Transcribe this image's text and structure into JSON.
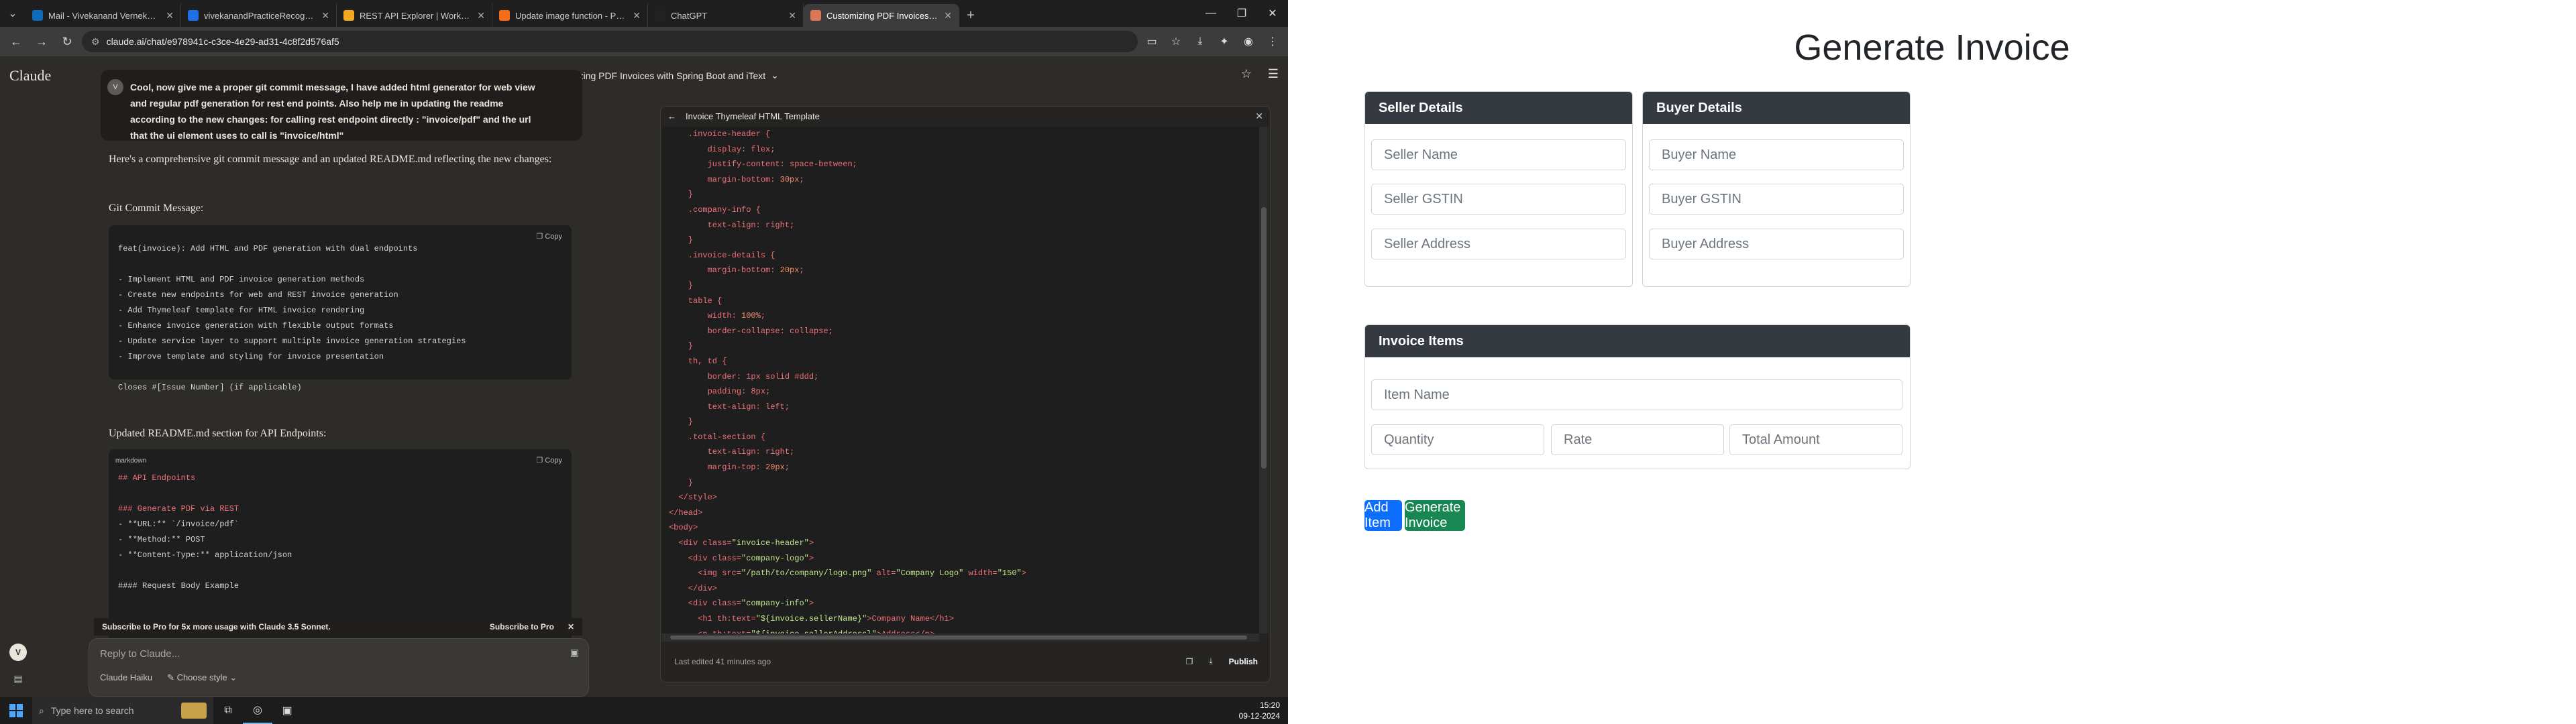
{
  "browser": {
    "tabs": [
      {
        "label": "Mail - Vivekanand Vernekar - O",
        "favicon_color": "#0f6cbd",
        "icon": "mail-icon"
      },
      {
        "label": "vivekanandPracticeRecognitio",
        "favicon_color": "#1f6feb",
        "icon": "github-icon"
      },
      {
        "label": "REST API Explorer | Workday Da",
        "favicon_color": "#f5a623",
        "icon": "workday-icon"
      },
      {
        "label": "Update image function - Post ·",
        "favicon_color": "#f76b15",
        "icon": "postman-icon"
      },
      {
        "label": "ChatGPT",
        "favicon_color": "#222222",
        "icon": "chatgpt-icon"
      },
      {
        "label": "Customizing PDF Invoices with",
        "favicon_color": "#d97757",
        "icon": "claude-icon",
        "active": true
      }
    ],
    "url": "claude.ai/chat/e978941c-c3ce-4e29-ad31-4c8f2d576af5"
  },
  "claude": {
    "brand": "Claude",
    "conversation_title": "Customizing PDF Invoices with Spring Boot and iText",
    "user_message": [
      "Cool, now give me a proper git commit message, I have added html generator for web view",
      "and regular pdf generation for rest end points. Also help me in updating the readme",
      "according to the new changes: for calling rest endpoint directly : \"invoice/pdf\" and the url",
      "that the ui element uses to call is \"invoice/html\""
    ],
    "user_initial": "V",
    "assistant_intro": "Here's a comprehensive git commit message and an updated README.md reflecting the new changes:",
    "git_heading": "Git Commit Message:",
    "copy_label": "Copy",
    "commit_lines": [
      "feat(invoice): Add HTML and PDF generation with dual endpoints",
      "",
      "- Implement HTML and PDF invoice generation methods",
      "- Create new endpoints for web and REST invoice generation",
      "- Add Thymeleaf template for HTML invoice rendering",
      "- Enhance invoice generation with flexible output formats",
      "- Update service layer to support multiple invoice generation strategies",
      "- Improve template and styling for invoice presentation",
      "",
      "Closes #[Issue Number] (if applicable)"
    ],
    "readme_heading": "Updated README.md section for API Endpoints:",
    "readme_lang": "markdown",
    "readme_lines": [
      "## API Endpoints",
      "",
      "### Generate PDF via REST",
      "- **URL:** `/invoice/pdf`",
      "- **Method:** POST",
      "- **Content-Type:** application/json",
      "",
      "#### Request Body Example"
    ],
    "promo_text": "Subscribe to Pro for 5x more usage with Claude 3.5 Sonnet.",
    "promo_button": "Subscribe to Pro",
    "input_placeholder": "Reply to Claude...",
    "model": "Claude Haiku",
    "style": "Choose style",
    "artifact": {
      "title": "Invoice Thymeleaf HTML Template",
      "footer": "Last edited 41 minutes ago",
      "publish": "Publish",
      "code_lines": [
        [
          [
            "p",
            "    .invoice-header {"
          ]
        ],
        [
          [
            "k",
            "        display"
          ],
          [
            "p",
            ": flex;"
          ]
        ],
        [
          [
            "k",
            "        justify-content"
          ],
          [
            "p",
            ": space-between;"
          ]
        ],
        [
          [
            "k",
            "        margin-bottom"
          ],
          [
            "p",
            ": "
          ],
          [
            "v",
            "30px"
          ],
          [
            "p",
            ";"
          ]
        ],
        [
          [
            "p",
            "    }"
          ]
        ],
        [
          [
            "p",
            "    .company-info {"
          ]
        ],
        [
          [
            "k",
            "        text-align"
          ],
          [
            "p",
            ": right;"
          ]
        ],
        [
          [
            "p",
            "    }"
          ]
        ],
        [
          [
            "p",
            "    .invoice-details {"
          ]
        ],
        [
          [
            "k",
            "        margin-bottom"
          ],
          [
            "p",
            ": "
          ],
          [
            "v",
            "20px"
          ],
          [
            "p",
            ";"
          ]
        ],
        [
          [
            "p",
            "    }"
          ]
        ],
        [
          [
            "p",
            "    table {"
          ]
        ],
        [
          [
            "k",
            "        width"
          ],
          [
            "p",
            ": "
          ],
          [
            "v",
            "100%"
          ],
          [
            "p",
            ";"
          ]
        ],
        [
          [
            "k",
            "        border-collapse"
          ],
          [
            "p",
            ": collapse;"
          ]
        ],
        [
          [
            "p",
            "    }"
          ]
        ],
        [
          [
            "p",
            "    th, td {"
          ]
        ],
        [
          [
            "k",
            "        border"
          ],
          [
            "p",
            ": 1px solid #ddd;"
          ]
        ],
        [
          [
            "k",
            "        padding"
          ],
          [
            "p",
            ": 8px;"
          ]
        ],
        [
          [
            "k",
            "        text-align"
          ],
          [
            "p",
            ": left;"
          ]
        ],
        [
          [
            "p",
            "    }"
          ]
        ],
        [
          [
            "p",
            "    .total-section {"
          ]
        ],
        [
          [
            "k",
            "        text-align"
          ],
          [
            "p",
            ": right;"
          ]
        ],
        [
          [
            "k",
            "        margin-top"
          ],
          [
            "p",
            ": "
          ],
          [
            "v",
            "20px"
          ],
          [
            "p",
            ";"
          ]
        ],
        [
          [
            "p",
            "    }"
          ]
        ],
        [
          [
            "p",
            "  </style>"
          ]
        ],
        [
          [
            "p",
            "</head>"
          ]
        ],
        [
          [
            "p",
            "<body>"
          ]
        ],
        [
          [
            "p",
            "  <div "
          ],
          [
            "k",
            "class"
          ],
          [
            "p",
            "="
          ],
          [
            "s",
            "\"invoice-header\""
          ],
          [
            "p",
            ">"
          ]
        ],
        [
          [
            "p",
            "    <div "
          ],
          [
            "k",
            "class"
          ],
          [
            "p",
            "="
          ],
          [
            "s",
            "\"company-logo\""
          ],
          [
            "p",
            ">"
          ]
        ],
        [
          [
            "p",
            "      <img "
          ],
          [
            "k",
            "src"
          ],
          [
            "p",
            "="
          ],
          [
            "s",
            "\"/path/to/company/logo.png\""
          ],
          [
            "p",
            " "
          ],
          [
            "k",
            "alt"
          ],
          [
            "p",
            "="
          ],
          [
            "s",
            "\"Company Logo\""
          ],
          [
            "p",
            " "
          ],
          [
            "k",
            "width"
          ],
          [
            "p",
            "="
          ],
          [
            "s",
            "\"150\""
          ],
          [
            "p",
            ">"
          ]
        ],
        [
          [
            "p",
            "    </div>"
          ]
        ],
        [
          [
            "p",
            "    <div "
          ],
          [
            "k",
            "class"
          ],
          [
            "p",
            "="
          ],
          [
            "s",
            "\"company-info\""
          ],
          [
            "p",
            ">"
          ]
        ],
        [
          [
            "p",
            "      <h1 "
          ],
          [
            "k",
            "th:text"
          ],
          [
            "p",
            "="
          ],
          [
            "s",
            "\"${invoice.sellerName}\""
          ],
          [
            "p",
            ">Company Name</h1>"
          ]
        ],
        [
          [
            "p",
            "      <p "
          ],
          [
            "k",
            "th:text"
          ],
          [
            "p",
            "="
          ],
          [
            "s",
            "\"${invoice.sellerAddress}\""
          ],
          [
            "p",
            ">Address</p>"
          ]
        ]
      ]
    }
  },
  "taskbar": {
    "search_placeholder": "Type here to search",
    "time": "15:20",
    "date": "09-12-2024"
  },
  "invoice": {
    "title": "Generate Invoice",
    "seller": {
      "header": "Seller Details",
      "name_placeholder": "Seller Name",
      "gstin_placeholder": "Seller GSTIN",
      "address_placeholder": "Seller Address"
    },
    "buyer": {
      "header": "Buyer Details",
      "name_placeholder": "Buyer Name",
      "gstin_placeholder": "Buyer GSTIN",
      "address_placeholder": "Buyer Address"
    },
    "items": {
      "header": "Invoice Items",
      "item_name_placeholder": "Item Name",
      "quantity_placeholder": "Quantity",
      "rate_placeholder": "Rate",
      "total_placeholder": "Total Amount"
    },
    "add_item_label": "Add Item",
    "generate_label": "Generate Invoice",
    "colors": {
      "primary": "#0d6efd",
      "success": "#198754",
      "header": "#343a40"
    }
  }
}
